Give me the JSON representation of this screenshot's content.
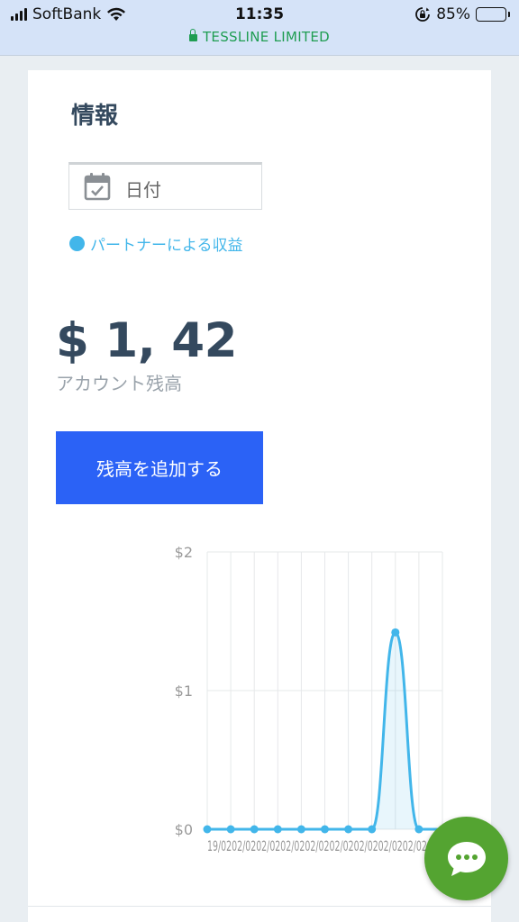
{
  "status_bar": {
    "carrier": "SoftBank",
    "time": "11:35",
    "battery_percent": "85%",
    "battery_level": 0.85
  },
  "url_bar": {
    "site": "TESSLINE LIMITED",
    "secure": true
  },
  "page": {
    "title": "情報",
    "date_filter": {
      "label": "日付",
      "icon": "calendar-icon"
    },
    "legend_label": "パートナーによる収益",
    "balance": {
      "value": "$ 1, 42",
      "label": "アカウント残高"
    },
    "add_balance_button": "残高を追加する",
    "chat_icon": "chat-bubble-icon"
  },
  "colors": {
    "accent_blue": "#42b6ea",
    "button_blue": "#2b62f6",
    "chat_green": "#54a431",
    "title_text": "#34495e",
    "secure_green": "#1f9d52"
  },
  "chart_data": {
    "type": "line",
    "y_tick_labels": [
      "$0",
      "$1",
      "$2"
    ],
    "ylim": [
      0,
      2
    ],
    "x_labels_visible_text": "19/0202/0202/0202/0202/0202/0202/0202/0202/0202/0",
    "x_label_first": "19/0",
    "x_label_last": "/0",
    "series": [
      {
        "values": [
          0,
          0,
          0,
          0,
          0,
          0,
          0,
          0,
          1.42,
          0,
          0
        ]
      }
    ],
    "grid": true,
    "legend": "none"
  }
}
